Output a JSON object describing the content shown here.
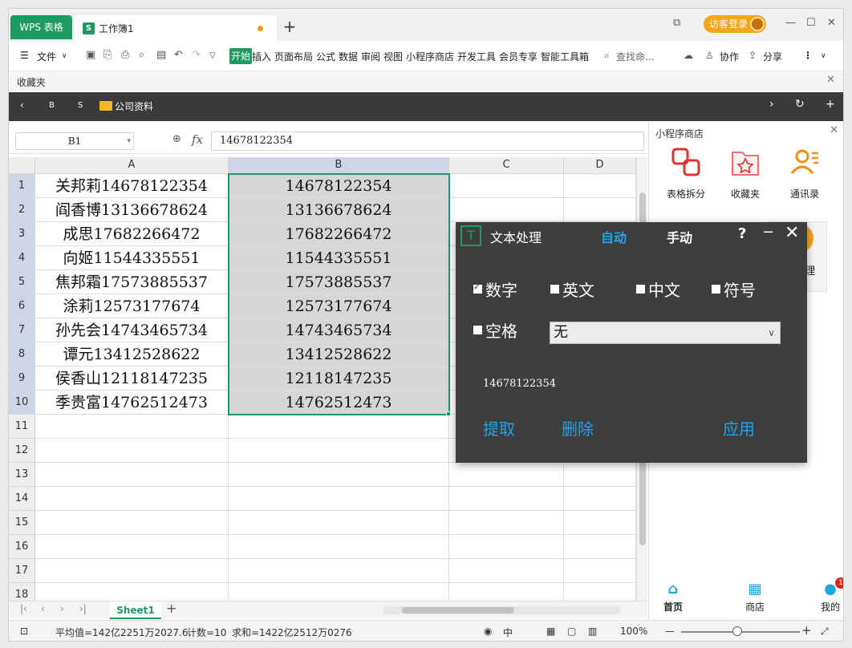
{
  "titlebar": {
    "wps_tab": "WPS 表格",
    "doc_tab": "工作簿1",
    "doc_icon": "S",
    "add_tab": "+",
    "guest_login": "访客登录"
  },
  "menubar": {
    "file": "文件",
    "start": "开始",
    "items": [
      "插入",
      "页面布局",
      "公式",
      "数据",
      "审阅",
      "视图",
      "小程序商店",
      "开发工具",
      "会员专享",
      "智能工具箱"
    ],
    "search_placeholder": "查找命...",
    "collab": "协作",
    "share": "分享"
  },
  "favorites": {
    "label": "收藏夹"
  },
  "navbar": {
    "b": "B",
    "s": "S",
    "folder": "公司资料"
  },
  "formula": {
    "cell_ref": "B1",
    "fx": "fx",
    "value": "14678122354"
  },
  "grid": {
    "columns": [
      "A",
      "B",
      "C",
      "D"
    ],
    "rows": [
      "1",
      "2",
      "3",
      "4",
      "5",
      "6",
      "7",
      "8",
      "9",
      "10",
      "11",
      "12",
      "13",
      "14",
      "15",
      "16",
      "17",
      "18"
    ],
    "col_a": [
      "关邦莉14678122354",
      "阎香博13136678624",
      "成思17682266472",
      "向姬11544335551",
      "焦邦霜17573885537",
      "涂莉12573177674",
      "孙先会14743465734",
      "谭元13412528622",
      "侯香山12118147235",
      "季贵富14762512473"
    ],
    "col_b": [
      "14678122354",
      "13136678624",
      "17682266472",
      "11544335551",
      "17573885537",
      "12573177674",
      "14743465734",
      "13412528622",
      "12118147235",
      "14762512473"
    ]
  },
  "sheets": {
    "active": "Sheet1",
    "add": "+"
  },
  "status": {
    "average": "平均值=142亿2251万2027.6",
    "count": "计数=10",
    "sum": "求和=1422亿2512万0276",
    "zoom": "100%"
  },
  "side_panel": {
    "title": "小程序商店",
    "apps": [
      "表格拆分",
      "收藏夹",
      "通讯录"
    ],
    "partial_label": "理",
    "tabs": [
      "首页",
      "商店",
      "我的"
    ],
    "badge": "1"
  },
  "dialog": {
    "logo": "T",
    "title": "文本处理",
    "mode_auto": "自动",
    "mode_manual": "手动",
    "help": "?",
    "options": {
      "digits": "数字",
      "english": "英文",
      "chinese": "中文",
      "symbols": "符号",
      "space": "空格"
    },
    "select_value": "无",
    "preview": "14678122354",
    "extract": "提取",
    "delete": "删除",
    "apply": "应用"
  },
  "colors": {
    "accent": "#1d9b62",
    "link": "#22a3ea",
    "guest": "#f4a51c"
  }
}
